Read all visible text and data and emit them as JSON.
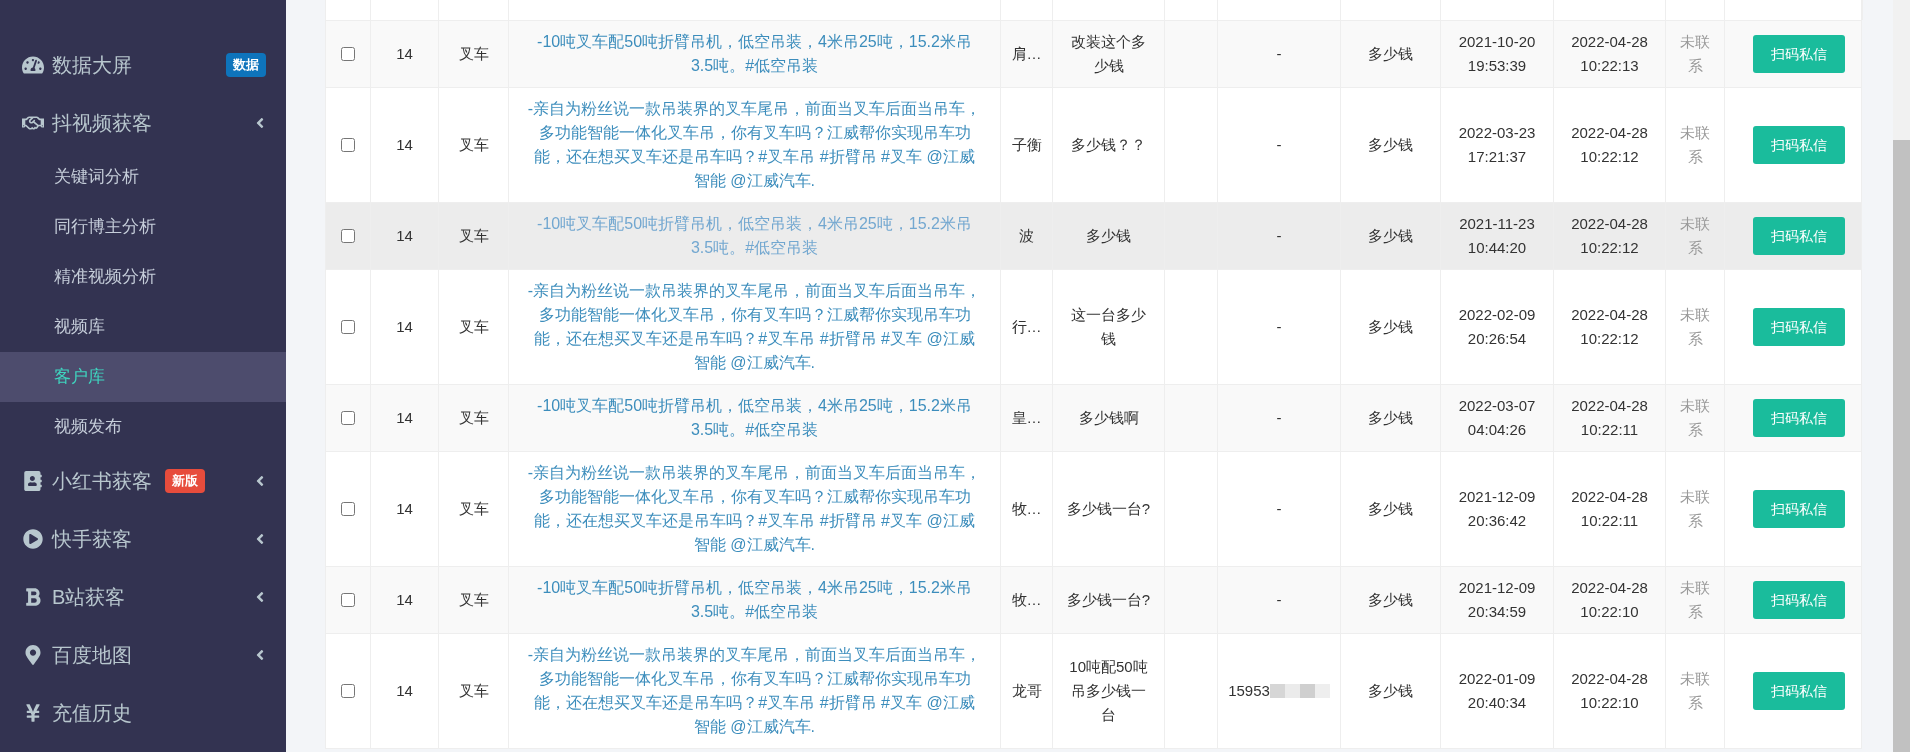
{
  "sidebar": {
    "items": [
      {
        "label": "数据大屏",
        "badge": {
          "text": "数据",
          "color": "#0e74bc"
        }
      },
      {
        "label": "抖视频获客",
        "has_submenu": true,
        "children": [
          {
            "label": "关键词分析",
            "selected": false
          },
          {
            "label": "同行博主分析",
            "selected": false
          },
          {
            "label": "精准视频分析",
            "selected": false
          },
          {
            "label": "视频库",
            "selected": false
          },
          {
            "label": "客户库",
            "selected": true
          },
          {
            "label": "视频发布",
            "selected": false
          }
        ]
      },
      {
        "label": "小红书获客",
        "has_submenu": true,
        "badge": {
          "text": "新版",
          "color": "#e74c3c"
        }
      },
      {
        "label": "快手获客",
        "has_submenu": true
      },
      {
        "label": "B站获客",
        "has_submenu": true
      },
      {
        "label": "百度地图",
        "has_submenu": true
      },
      {
        "label": "充值历史"
      }
    ]
  },
  "table": {
    "rows": [
      {
        "checked": false,
        "highlighted": false,
        "id": "14",
        "category": "叉车",
        "title": "-10吨叉车配50吨折臂吊机，低空吊装，4米吊25吨，15.2米吊3.5吨。#低空吊装",
        "visited": false,
        "name": "肩…",
        "comment": "改装这个多少钱",
        "phone": "-",
        "keyword": "多少钱",
        "created": "2021-10-20 19:53:39",
        "updated": "2022-04-28 10:22:13",
        "status": "未联系",
        "action": "扫码私信"
      },
      {
        "checked": false,
        "highlighted": false,
        "id": "14",
        "category": "叉车",
        "title": "-亲自为粉丝说一款吊装界的叉车尾吊，前面当叉车后面当吊车，多功能智能一体化叉车吊，你有叉车吗？江威帮你实现吊车功能，还在想买叉车还是吊车吗？#叉车吊 #折臂吊 #叉车 @江威智能 @江威汽车.",
        "visited": false,
        "name": "子衡",
        "comment": "多少钱？？",
        "phone": "-",
        "keyword": "多少钱",
        "created": "2022-03-23 17:21:37",
        "updated": "2022-04-28 10:22:12",
        "status": "未联系",
        "action": "扫码私信"
      },
      {
        "checked": false,
        "highlighted": true,
        "id": "14",
        "category": "叉车",
        "title": "-10吨叉车配50吨折臂吊机，低空吊装，4米吊25吨，15.2米吊3.5吨。#低空吊装",
        "visited": true,
        "name": "波",
        "comment": "多少钱",
        "phone": "-",
        "keyword": "多少钱",
        "created": "2021-11-23 10:44:20",
        "updated": "2022-04-28 10:22:12",
        "status": "未联系",
        "action": "扫码私信"
      },
      {
        "checked": false,
        "highlighted": false,
        "id": "14",
        "category": "叉车",
        "title": "-亲自为粉丝说一款吊装界的叉车尾吊，前面当叉车后面当吊车，多功能智能一体化叉车吊，你有叉车吗？江威帮你实现吊车功能，还在想买叉车还是吊车吗？#叉车吊 #折臂吊 #叉车 @江威智能 @江威汽车.",
        "visited": false,
        "name": "行…",
        "comment": "这一台多少钱",
        "phone": "-",
        "keyword": "多少钱",
        "created": "2022-02-09 20:26:54",
        "updated": "2022-04-28 10:22:12",
        "status": "未联系",
        "action": "扫码私信"
      },
      {
        "checked": false,
        "highlighted": false,
        "id": "14",
        "category": "叉车",
        "title": "-10吨叉车配50吨折臂吊机，低空吊装，4米吊25吨，15.2米吊3.5吨。#低空吊装",
        "visited": false,
        "name": "皇…",
        "comment": "多少钱啊",
        "phone": "-",
        "keyword": "多少钱",
        "created": "2022-03-07 04:04:26",
        "updated": "2022-04-28 10:22:11",
        "status": "未联系",
        "action": "扫码私信"
      },
      {
        "checked": false,
        "highlighted": false,
        "id": "14",
        "category": "叉车",
        "title": "-亲自为粉丝说一款吊装界的叉车尾吊，前面当叉车后面当吊车，多功能智能一体化叉车吊，你有叉车吗？江威帮你实现吊车功能，还在想买叉车还是吊车吗？#叉车吊 #折臂吊 #叉车 @江威智能 @江威汽车.",
        "visited": false,
        "name": "牧…",
        "comment": "多少钱一台?",
        "phone": "-",
        "keyword": "多少钱",
        "created": "2021-12-09 20:36:42",
        "updated": "2022-04-28 10:22:11",
        "status": "未联系",
        "action": "扫码私信"
      },
      {
        "checked": false,
        "highlighted": false,
        "id": "14",
        "category": "叉车",
        "title": "-10吨叉车配50吨折臂吊机，低空吊装，4米吊25吨，15.2米吊3.5吨。#低空吊装",
        "visited": false,
        "name": "牧…",
        "comment": "多少钱一台?",
        "phone": "-",
        "keyword": "多少钱",
        "created": "2021-12-09 20:34:59",
        "updated": "2022-04-28 10:22:10",
        "status": "未联系",
        "action": "扫码私信"
      },
      {
        "checked": false,
        "highlighted": false,
        "id": "14",
        "category": "叉车",
        "title": "-亲自为粉丝说一款吊装界的叉车尾吊，前面当叉车后面当吊车，多功能智能一体化叉车吊，你有叉车吗？江威帮你实现吊车功能，还在想买叉车还是吊车吗？#叉车吊 #折臂吊 #叉车 @江威智能 @江威汽车.",
        "visited": false,
        "name": "龙哥",
        "comment": "10吨配50吨吊多少钱一台",
        "phone": "15953",
        "phone_redacted": true,
        "keyword": "多少钱",
        "created": "2022-01-09 20:40:34",
        "updated": "2022-04-28 10:22:10",
        "status": "未联系",
        "action": "扫码私信"
      }
    ]
  }
}
